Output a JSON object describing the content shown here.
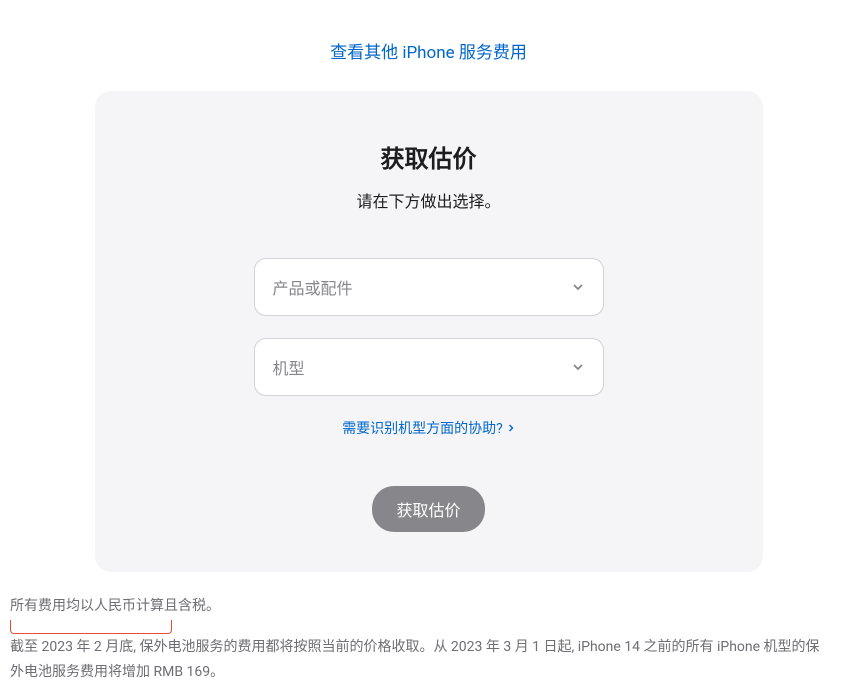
{
  "topLink": {
    "text": "查看其他 iPhone 服务费用"
  },
  "card": {
    "title": "获取估价",
    "subtitle": "请在下方做出选择。",
    "select1": {
      "placeholder": "产品或配件"
    },
    "select2": {
      "placeholder": "机型"
    },
    "helpLink": {
      "text": "需要识别机型方面的协助?"
    },
    "submitButton": {
      "label": "获取估价"
    }
  },
  "footer": {
    "line1": "所有费用均以人民币计算且含税。",
    "line2_part1": "截至 2023 年 2 月底, 保外电池服务的费用都将按照当前的价格收取。从 2023 年 3 月 1 日起, iPhone 14 之前的所有 iPhone 机型的保外电池服务",
    "line2_part2": "费用将增加 RMB 169。"
  }
}
